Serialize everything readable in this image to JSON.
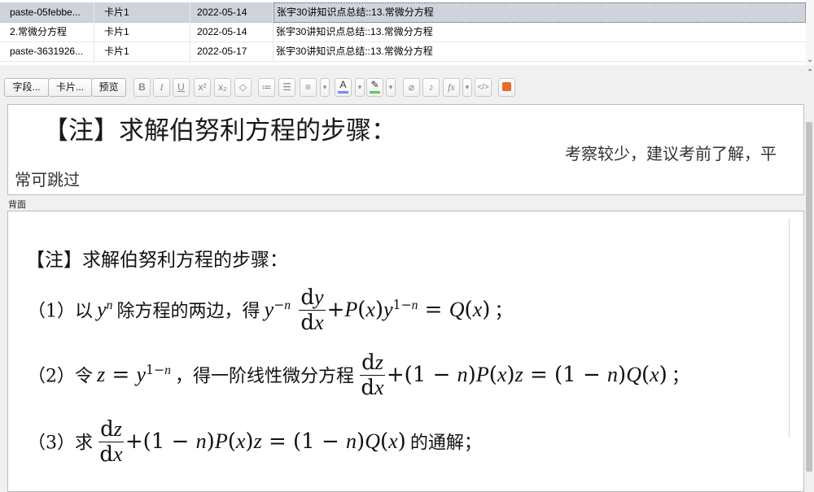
{
  "table": {
    "rows": [
      {
        "sort_field": "paste-05febbe...",
        "card": "卡片1",
        "date": "2022-05-14",
        "deck": "张宇30讲知识点总结::13.常微分方程",
        "selected": true
      },
      {
        "sort_field": "2.常微分方程",
        "card": "卡片1",
        "date": "2022-05-14",
        "deck": "张宇30讲知识点总结::13.常微分方程",
        "selected": false
      },
      {
        "sort_field": "paste-3631926...",
        "card": "卡片1",
        "date": "2022-05-17",
        "deck": "张宇30讲知识点总结::13.常微分方程",
        "selected": false
      }
    ]
  },
  "toolbar": {
    "fields_label": "字段...",
    "cards_label": "卡片...",
    "preview_label": "预览",
    "icons": [
      {
        "name": "bold-icon",
        "glyph": "B"
      },
      {
        "name": "italic-icon",
        "glyph": "I"
      },
      {
        "name": "underline-icon",
        "glyph": "U"
      },
      {
        "name": "superscript-icon",
        "glyph": "x²"
      },
      {
        "name": "subscript-icon",
        "glyph": "x₂"
      },
      {
        "name": "eraser-icon",
        "glyph": "◇"
      },
      {
        "name": "unordered-list-icon",
        "glyph": "≔"
      },
      {
        "name": "ordered-list-icon",
        "glyph": "☰"
      },
      {
        "name": "align-icon",
        "glyph": "≡"
      },
      {
        "name": "text-color-icon",
        "glyph": "A"
      },
      {
        "name": "highlight-icon",
        "glyph": "✎"
      },
      {
        "name": "attach-icon",
        "glyph": "⌀"
      },
      {
        "name": "microphone-icon",
        "glyph": "♪"
      },
      {
        "name": "function-icon",
        "glyph": "fx"
      },
      {
        "name": "html-editor-icon",
        "glyph": "</>"
      },
      {
        "name": "image-occlusion-icon",
        "glyph": "▣"
      }
    ],
    "text_color": "#7f86ff",
    "highlight_color": "#5dc95d",
    "occlusion_color": "#e86a2c"
  },
  "front": {
    "title": "【注】求解伯努利方程的步骤：",
    "note_line1": "考察较少，建议考前了解，平",
    "note_line2": "常可跳过"
  },
  "back_label": "背面",
  "back": {
    "title": "【注】求解伯努利方程的步骤：",
    "step1_prefix": "（1）以",
    "step1_mid": "除方程的两边，得",
    "step1_end": "；",
    "step2_prefix": "（2）令",
    "step2_mid": "，得一阶线性微分方程",
    "step2_end": "；",
    "step3_prefix": "（3）求",
    "step3_end": "的通解；"
  }
}
